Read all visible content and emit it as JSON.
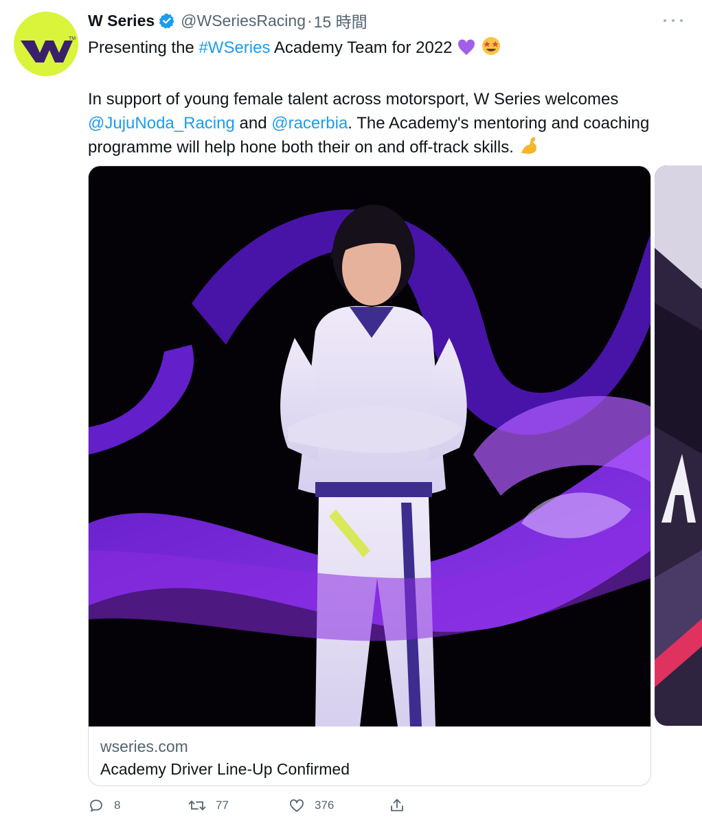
{
  "tweet": {
    "author": {
      "name": "W Series",
      "handle": "@WSeriesRacing",
      "separator": "·",
      "time": "15 時間",
      "verified": true
    },
    "text": {
      "line1_prefix": "Presenting the ",
      "hashtag": "#WSeries",
      "line1_suffix": " Academy Team for 2022",
      "para2_prefix": "In support of young female talent across motorsport, W Series welcomes ",
      "mention1": "@JujuNoda_Racing",
      "and": " and ",
      "mention2": "@racerbia",
      "para2_suffix": ". The Academy's mentoring and coaching programme will help hone both their on and off-track skills."
    },
    "emojis": [
      "purple-heart",
      "star-struck",
      "flexed-biceps"
    ],
    "card": {
      "domain": "wseries.com",
      "title": "Academy Driver Line-Up Confirmed"
    },
    "actions": {
      "replies": "8",
      "retweets": "77",
      "likes": "376"
    },
    "colors": {
      "accent": "#1d9bf0",
      "avatar_bg": "#d9f43a",
      "brand_purple": "#8a2be2"
    }
  }
}
